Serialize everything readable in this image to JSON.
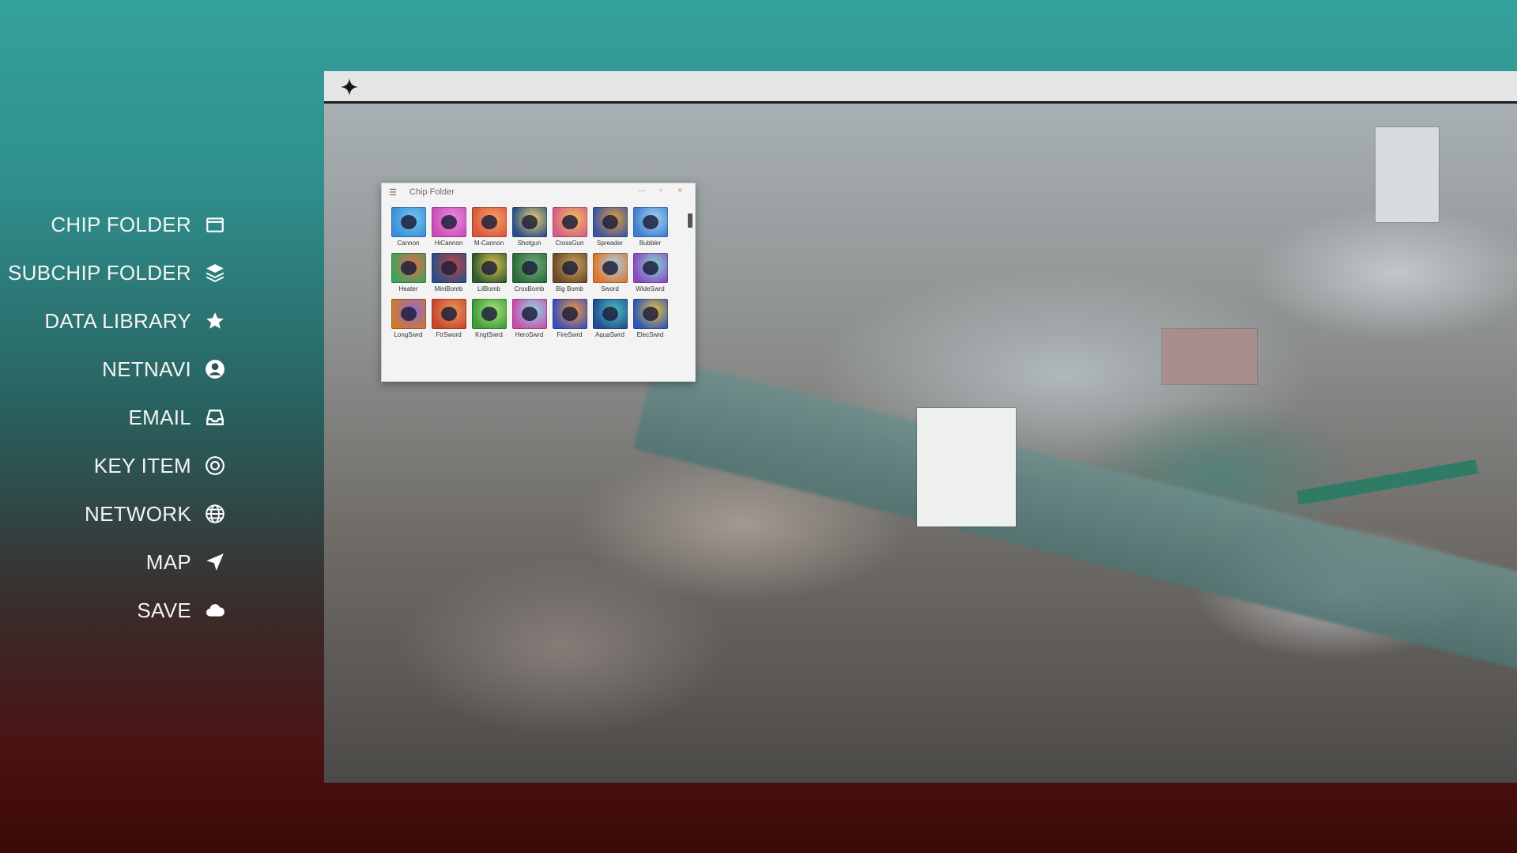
{
  "menu": {
    "items": [
      {
        "label": "CHIP FOLDER",
        "icon": "folder-icon"
      },
      {
        "label": "SUBCHIP FOLDER",
        "icon": "layers-icon"
      },
      {
        "label": "DATA LIBRARY",
        "icon": "star-icon"
      },
      {
        "label": "NETNAVI",
        "icon": "user-icon"
      },
      {
        "label": "EMAIL",
        "icon": "inbox-icon"
      },
      {
        "label": "KEY ITEM",
        "icon": "target-icon"
      },
      {
        "label": "NETWORK",
        "icon": "globe-icon"
      },
      {
        "label": "MAP",
        "icon": "navigation-arrow-icon"
      },
      {
        "label": "SAVE",
        "icon": "cloud-icon"
      }
    ]
  },
  "desktop": {
    "topbar_icon": "sparkle-icon"
  },
  "chip_folder": {
    "title": "Chip Folder",
    "buttons": {
      "minimize": "—",
      "maximize": "+",
      "close": "×"
    },
    "chips": [
      {
        "name": "Cannon",
        "colors": [
          "#3a8fd8",
          "#77c6f0"
        ]
      },
      {
        "name": "HiCannon",
        "colors": [
          "#c84fb8",
          "#f08adf"
        ]
      },
      {
        "name": "M-Cannon",
        "colors": [
          "#d9573a",
          "#f5a36a"
        ]
      },
      {
        "name": "Shotgun",
        "colors": [
          "#2a4f8a",
          "#f2d36a"
        ]
      },
      {
        "name": "CrossGun",
        "colors": [
          "#d65d8c",
          "#f6c04e"
        ]
      },
      {
        "name": "Spreader",
        "colors": [
          "#3b56a6",
          "#e7a037"
        ]
      },
      {
        "name": "Bubbler",
        "colors": [
          "#3d7fcf",
          "#a7d4f5"
        ]
      },
      {
        "name": "Heater",
        "colors": [
          "#3fa25b",
          "#e86a4a"
        ]
      },
      {
        "name": "MiniBomb",
        "colors": [
          "#2b4e86",
          "#c7453d"
        ]
      },
      {
        "name": "LilBomb",
        "colors": [
          "#2e5b2f",
          "#e2c44a"
        ]
      },
      {
        "name": "CrosBomb",
        "colors": [
          "#2e6a3a",
          "#6fb07a"
        ]
      },
      {
        "name": "Big Bomb",
        "colors": [
          "#6b4b2a",
          "#c9a35a"
        ]
      },
      {
        "name": "Sword",
        "colors": [
          "#e0762a",
          "#9fd4f0"
        ]
      },
      {
        "name": "WideSwrd",
        "colors": [
          "#8c48c2",
          "#7fe0d0"
        ]
      },
      {
        "name": "LongSwrd",
        "colors": [
          "#d07a2a",
          "#8a6ad8"
        ]
      },
      {
        "name": "FtrSword",
        "colors": [
          "#c9462f",
          "#e99a55"
        ]
      },
      {
        "name": "KngtSwrd",
        "colors": [
          "#3f9a3a",
          "#a9e47c"
        ]
      },
      {
        "name": "HeroSwrd",
        "colors": [
          "#c74fa7",
          "#8fd9f2"
        ]
      },
      {
        "name": "FireSwrd",
        "colors": [
          "#3a4fb8",
          "#f29a3b"
        ]
      },
      {
        "name": "AquaSwrd",
        "colors": [
          "#1f4f8f",
          "#4ec0c4"
        ]
      },
      {
        "name": "ElecSwrd",
        "colors": [
          "#2a57b8",
          "#f2c23a"
        ]
      }
    ]
  }
}
